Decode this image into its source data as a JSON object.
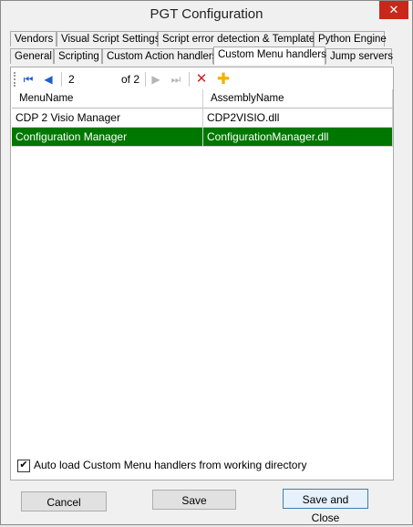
{
  "window": {
    "title": "PGT Configuration",
    "close_glyph": "✕"
  },
  "tabs": {
    "row1": [
      "Vendors",
      "Visual Script Settings",
      "Script error detection & Templates",
      "Python Engine"
    ],
    "row2": [
      "General",
      "Scripting",
      "Custom Action handlers",
      "Custom Menu handlers",
      "Jump servers"
    ],
    "active": "Custom Menu handlers"
  },
  "navigator": {
    "position": "2",
    "of_label": "of 2",
    "icons": [
      "first-record-icon",
      "previous-record-icon",
      "next-record-icon",
      "last-record-icon",
      "delete-icon",
      "add-icon"
    ]
  },
  "grid": {
    "columns": [
      "MenuName",
      "AssemblyName"
    ],
    "rows": [
      {
        "menu_name": "CDP 2 Visio Manager",
        "assembly_name": "CDP2VISIO.dll"
      },
      {
        "menu_name": "Configuration Manager",
        "assembly_name": "ConfigurationManager.dll"
      }
    ],
    "selected_row": 1,
    "selection_color": "#007700"
  },
  "options": {
    "autoload_label": "Auto load Custom Menu handlers from working directory",
    "autoload_checked": true
  },
  "buttons": {
    "cancel": "Cancel",
    "save": "Save",
    "save_close": "Save and Close"
  }
}
